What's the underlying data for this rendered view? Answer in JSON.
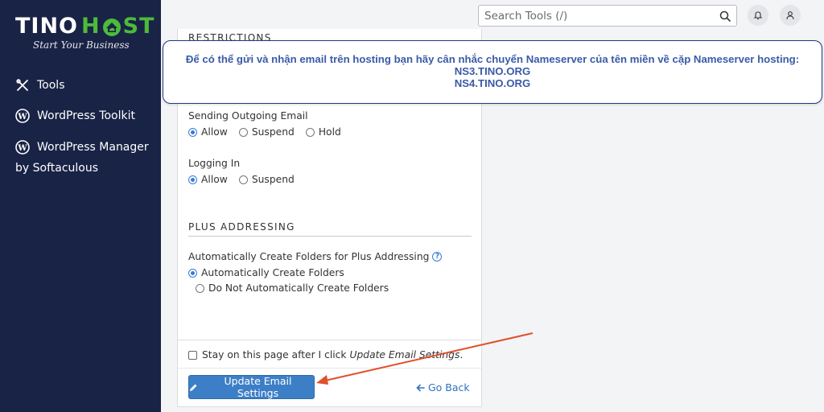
{
  "brand": {
    "name_part1": "TINO",
    "name_part2": "H",
    "name_part3": "ST",
    "tagline": "Start Your Business"
  },
  "sidebar": {
    "items": [
      {
        "label": "Tools",
        "icon": "tools-icon"
      },
      {
        "label": "WordPress Toolkit",
        "icon": "wordpress-icon"
      },
      {
        "label": "WordPress Manager",
        "icon": "wordpress-icon",
        "sublabel": "by Softaculous"
      }
    ]
  },
  "header": {
    "search_placeholder": "Search Tools (/)",
    "search_icon": "search-icon",
    "bell_icon": "bell-icon",
    "user_icon": "user-icon"
  },
  "notice": {
    "line1": "Để có thể gửi và nhận email trên hosting bạn hãy cân nhắc chuyển Nameserver của tên miền về cặp Nameserver hosting:",
    "line2": "NS3.TINO.ORG",
    "line3": "NS4.TINO.ORG"
  },
  "form": {
    "restrictions_heading": "RESTRICTIONS",
    "sending": {
      "label": "Sending Outgoing Email",
      "options": [
        "Allow",
        "Suspend",
        "Hold"
      ],
      "selected": "Allow"
    },
    "login": {
      "label": "Logging In",
      "options": [
        "Allow",
        "Suspend"
      ],
      "selected": "Allow"
    },
    "plus_heading": "PLUS ADDRESSING",
    "plus": {
      "label": "Automatically Create Folders for Plus Addressing",
      "options": [
        "Automatically Create Folders",
        "Do Not Automatically Create Folders"
      ],
      "selected": "Automatically Create Folders"
    },
    "stay_label_prefix": "Stay on this page after I click ",
    "stay_label_em": "Update Email Settings",
    "stay_label_suffix": ".",
    "stay_checked": false,
    "submit_label": "Update Email Settings",
    "back_label": "Go Back"
  },
  "colors": {
    "sidebar_bg": "#192346",
    "brand_green": "#4dbb3a",
    "primary": "#3d7fc7",
    "link": "#2f72c0",
    "notice_text": "#3b5aa8",
    "annotation": "#e0502a"
  }
}
